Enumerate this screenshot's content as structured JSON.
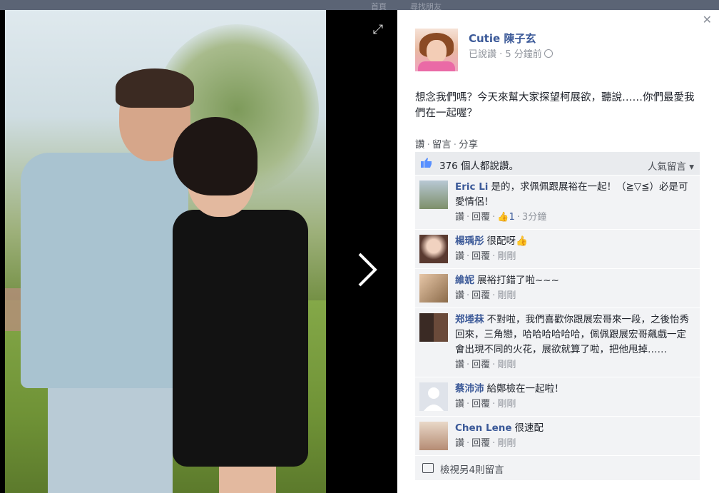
{
  "background_nav": {
    "items": [
      "... ",
      "首頁",
      "尋找朋友"
    ]
  },
  "post": {
    "author": "Cutie 陳子玄",
    "meta": "已說讚 · 5 分鐘前",
    "text": "想念我們嗎？今天來幫大家探望柯展欲，聽說……你們最愛我們在一起喔？",
    "actions": [
      "讚",
      "留言",
      "分享"
    ],
    "likes": "376 個人都說讚。",
    "sort_label": "人氣留言 ▾"
  },
  "comments": [
    {
      "name": "Eric Li",
      "text": "是的，求佩佩跟展裕在一起！（≧▽≦）必是可愛情侶！",
      "like": "讚",
      "reply": "回覆",
      "like_count": "1",
      "time": "3分鐘",
      "avatar_color": "#8fa7b8"
    },
    {
      "name": "楊瑀彤",
      "text": "很配呀👍",
      "like": "讚",
      "reply": "回覆",
      "time": "剛剛",
      "avatar_color": "#d9a78f"
    },
    {
      "name": "維妮",
      "text": "展裕打錯了啦~~~",
      "like": "讚",
      "reply": "回覆",
      "time": "剛剛",
      "avatar_color": "#c6b08f"
    },
    {
      "name": "郑堘菻",
      "text": "不對啦，我們喜歡你跟展宏哥來一段，之後怡秀回來，三角戀，哈哈哈哈哈哈，佩佩跟展宏哥飆戲一定會出現不同的火花，展欲就算了啦，把他甩掉……",
      "like": "讚",
      "reply": "回覆",
      "time": "剛剛",
      "avatar_color": "#5a4438"
    },
    {
      "name": "蔡沛沛",
      "text": "給鄭檢在一起啦！",
      "like": "讚",
      "reply": "回覆",
      "time": "剛剛",
      "avatar_color": "#c9cfd8"
    },
    {
      "name": "Chen Lene",
      "text": "很速配",
      "like": "讚",
      "reply": "回覆",
      "time": "剛剛",
      "avatar_color": "#b58c74"
    }
  ],
  "more_comments": "檢視另4則留言",
  "icons": {
    "close": "close-icon",
    "expand": "expand-icon",
    "next": "chevron-right-icon"
  },
  "colors": {
    "link": "#3b5998",
    "ufi_bg": "#f2f3f5"
  }
}
